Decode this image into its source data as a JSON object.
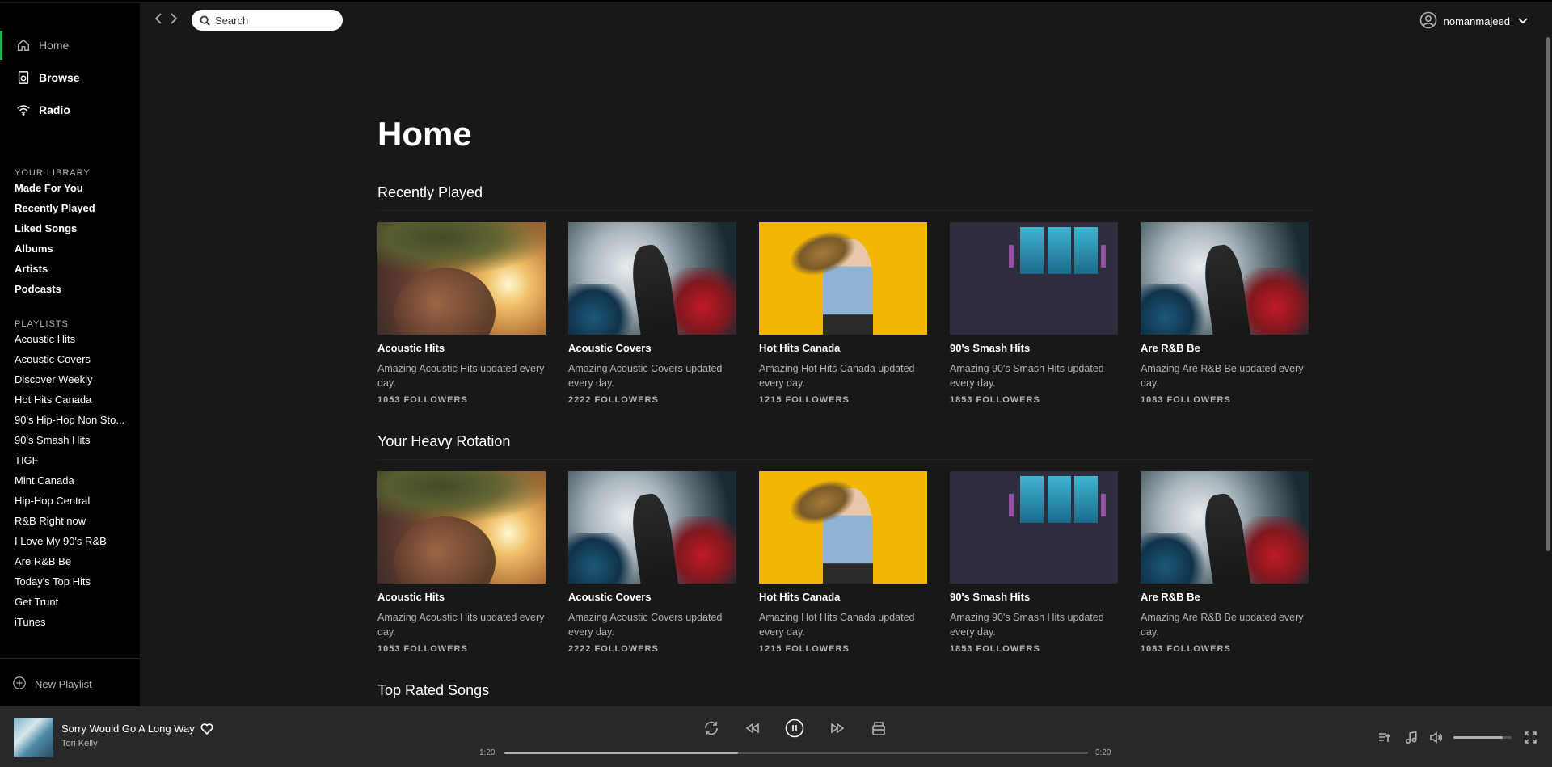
{
  "sidebar": {
    "nav": [
      {
        "label": "Home",
        "icon": "home-icon"
      },
      {
        "label": "Browse",
        "icon": "browse-icon"
      },
      {
        "label": "Radio",
        "icon": "radio-icon"
      }
    ],
    "library_title": "YOUR LIBRARY",
    "library": [
      "Made For You",
      "Recently Played",
      "Liked Songs",
      "Albums",
      "Artists",
      "Podcasts"
    ],
    "playlists_title": "PLAYLISTS",
    "playlists": [
      "Acoustic Hits",
      "Acoustic Covers",
      "Discover Weekly",
      "Hot Hits Canada",
      "90's Hip-Hop Non Sto...",
      "90's Smash Hits",
      "TIGF",
      "Mint Canada",
      "Hip-Hop Central",
      "R&B Right now",
      "I Love My 90's R&B",
      "Are R&B Be",
      "Today's Top Hits",
      "Get Trunt",
      "iTunes"
    ],
    "new_playlist": "New Playlist"
  },
  "topbar": {
    "search_placeholder": "Search",
    "username": "nomanmajeed"
  },
  "main": {
    "title": "Home",
    "sections": [
      {
        "title": "Recently Played",
        "cards": [
          {
            "title": "Acoustic Hits",
            "desc": "Amazing Acoustic Hits updated every day.",
            "followers": "1053 FOLLOWERS",
            "art": "acoustic"
          },
          {
            "title": "Acoustic Covers",
            "desc": "Amazing Acoustic Covers updated every day.",
            "followers": "2222 FOLLOWERS",
            "art": "smoke"
          },
          {
            "title": "Hot Hits Canada",
            "desc": "Amazing Hot Hits Canada updated every day.",
            "followers": "1215 FOLLOWERS",
            "art": "yellow"
          },
          {
            "title": "90's Smash Hits",
            "desc": "Amazing 90's Smash Hits updated every day.",
            "followers": "1853 FOLLOWERS",
            "art": "concert"
          },
          {
            "title": "Are R&B Be",
            "desc": "Amazing Are R&B Be updated every day.",
            "followers": "1083 FOLLOWERS",
            "art": "smoke"
          }
        ]
      },
      {
        "title": "Your Heavy Rotation",
        "cards": [
          {
            "title": "Acoustic Hits",
            "desc": "Amazing Acoustic Hits updated every day.",
            "followers": "1053 FOLLOWERS",
            "art": "acoustic"
          },
          {
            "title": "Acoustic Covers",
            "desc": "Amazing Acoustic Covers updated every day.",
            "followers": "2222 FOLLOWERS",
            "art": "smoke"
          },
          {
            "title": "Hot Hits Canada",
            "desc": "Amazing Hot Hits Canada updated every day.",
            "followers": "1215 FOLLOWERS",
            "art": "yellow"
          },
          {
            "title": "90's Smash Hits",
            "desc": "Amazing 90's Smash Hits updated every day.",
            "followers": "1853 FOLLOWERS",
            "art": "concert"
          },
          {
            "title": "Are R&B Be",
            "desc": "Amazing Are R&B Be updated every day.",
            "followers": "1083 FOLLOWERS",
            "art": "smoke"
          }
        ]
      },
      {
        "title": "Top Rated Songs",
        "cards": []
      }
    ]
  },
  "player": {
    "track": "Sorry Would Go A Long Way",
    "artist": "Tori Kelly",
    "elapsed": "1:20",
    "duration": "3:20",
    "progress": 0.4,
    "volume": 0.85,
    "accent": "#1db954"
  }
}
